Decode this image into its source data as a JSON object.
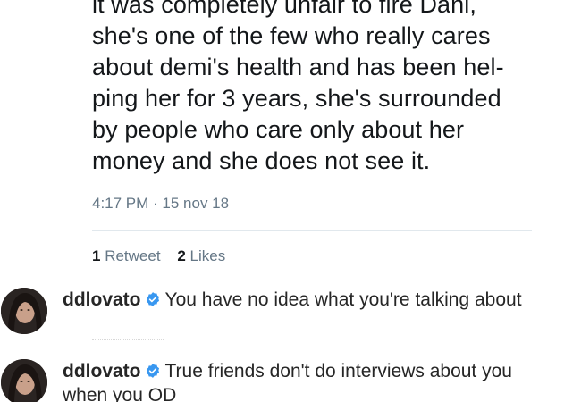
{
  "tweet": {
    "lines": [
      "it was completely unfair to fire Dani,",
      "she's one of the few who really cares",
      "about demi's health and has been hel-",
      "ping her for 3 years, she's surrounded",
      "by people who care only about her",
      "money and she does not see it."
    ],
    "timestamp": "4:17 PM · 15 nov 18",
    "retweets_count": "1",
    "retweets_label": "Retweet",
    "likes_count": "2",
    "likes_label": "Likes"
  },
  "comments": [
    {
      "username": "ddlovato",
      "text": "You have no idea what you're talking about"
    },
    {
      "username": "ddlovato",
      "text": "True friends don't do interviews about you when you OD"
    }
  ],
  "colors": {
    "verified_badge": "#3897f0",
    "meta_gray": "#657786"
  },
  "icons": {
    "verified": "verified-badge-icon",
    "avatar": "profile-avatar"
  }
}
